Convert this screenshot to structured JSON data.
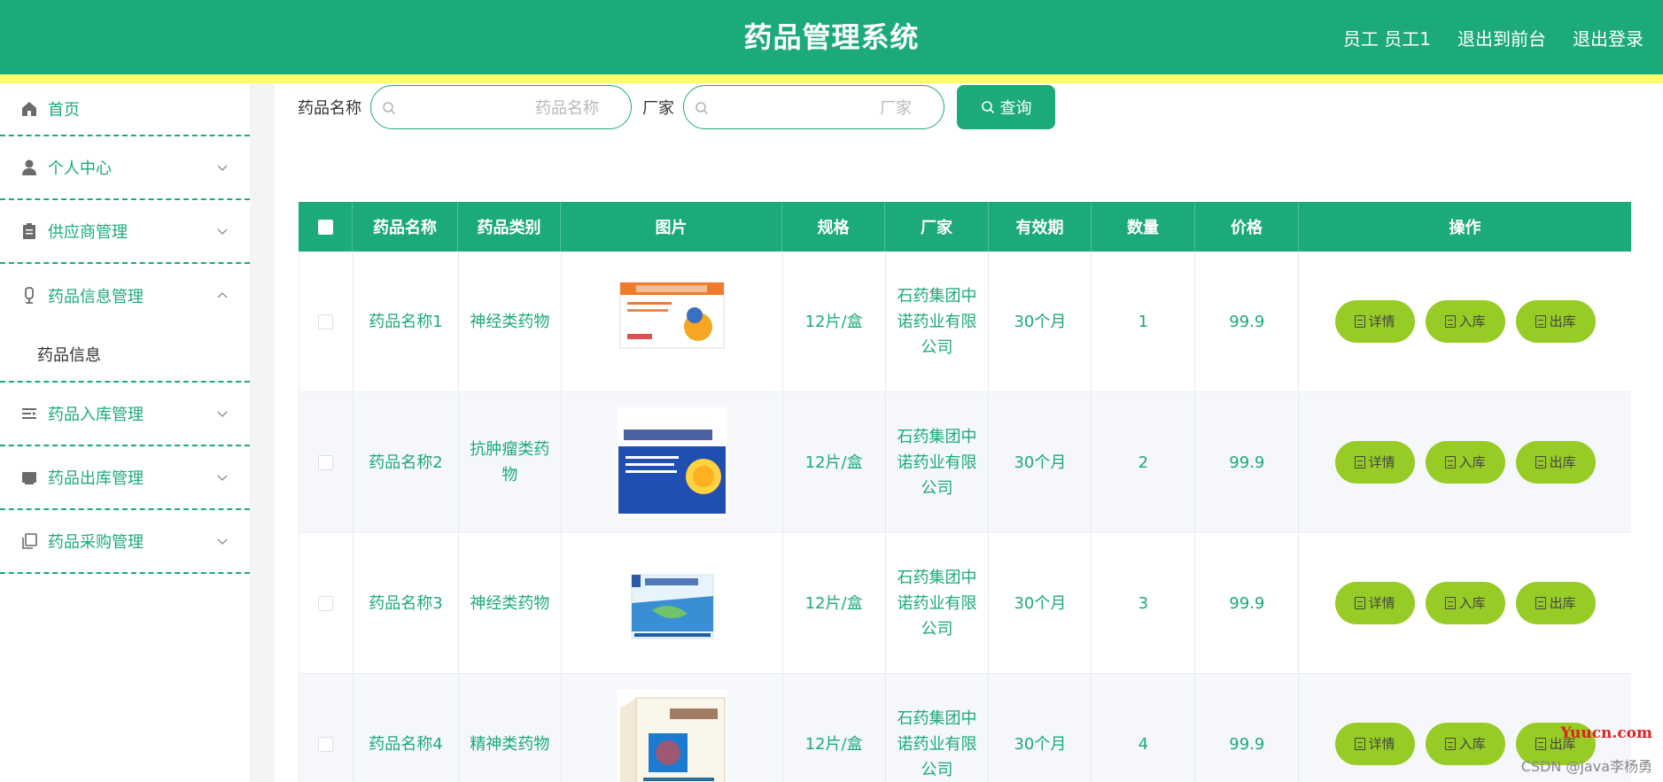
{
  "header": {
    "title": "药品管理系统",
    "user": "员工 员工1",
    "front_link": "退出到前台",
    "logout": "退出登录",
    "color": "#1caa79"
  },
  "sidebar": {
    "items": [
      {
        "label": "首页",
        "icon": "home-icon"
      },
      {
        "label": "个人中心",
        "icon": "user-icon"
      },
      {
        "label": "供应商管理",
        "icon": "clipboard-icon"
      },
      {
        "label": "药品信息管理",
        "icon": "mic-icon",
        "expanded": true,
        "children": [
          "药品信息"
        ]
      },
      {
        "label": "药品入库管理",
        "icon": "list-icon"
      },
      {
        "label": "药品出库管理",
        "icon": "box-icon"
      },
      {
        "label": "药品采购管理",
        "icon": "copy-icon"
      }
    ]
  },
  "search": {
    "name_label": "药品名称",
    "name_placeholder": "药品名称",
    "maker_label": "厂家",
    "maker_placeholder": "厂家",
    "button": "查询"
  },
  "table": {
    "headers": [
      "药品名称",
      "药品类别",
      "图片",
      "规格",
      "厂家",
      "有效期",
      "数量",
      "价格",
      "操作"
    ],
    "rows": [
      {
        "name": "药品名称1",
        "category": "神经类药物",
        "spec": "12片/盒",
        "maker": "石药集团中诺药业有限公司",
        "validity": "30个月",
        "qty": "1",
        "price": "99.9",
        "image": "medicine-box-1"
      },
      {
        "name": "药品名称2",
        "category": "抗肿瘤类药物",
        "spec": "12片/盒",
        "maker": "石药集团中诺药业有限公司",
        "validity": "30个月",
        "qty": "2",
        "price": "99.9",
        "image": "medicine-box-2"
      },
      {
        "name": "药品名称3",
        "category": "神经类药物",
        "spec": "12片/盒",
        "maker": "石药集团中诺药业有限公司",
        "validity": "30个月",
        "qty": "3",
        "price": "99.9",
        "image": "medicine-box-3"
      },
      {
        "name": "药品名称4",
        "category": "精神类药物",
        "spec": "12片/盒",
        "maker": "石药集团中诺药业有限公司",
        "validity": "30个月",
        "qty": "4",
        "price": "99.9",
        "image": "medicine-box-4"
      }
    ],
    "actions": [
      "详情",
      "入库",
      "出库"
    ]
  },
  "watermark": {
    "site": "Yuucn.com",
    "author": "CSDN @java李杨勇"
  }
}
